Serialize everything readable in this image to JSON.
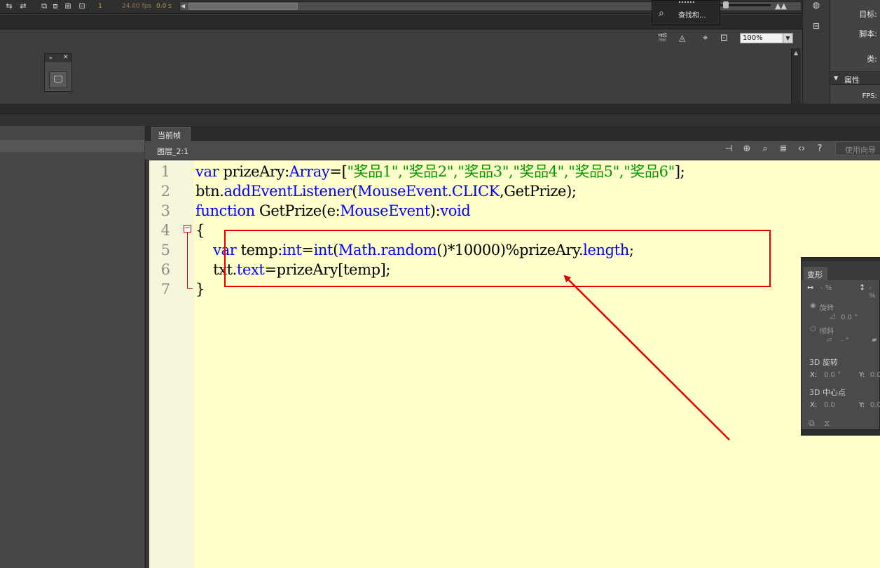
{
  "timeline": {
    "frame": "1",
    "fps": "24.00 fps",
    "time": "0.0 s"
  },
  "find_popup": {
    "label": "查找和..."
  },
  "stage": {
    "zoom": "100%"
  },
  "properties": {
    "target_label": "目标:",
    "script_label": "脚本:",
    "class_label": "类:",
    "section_title": "属性",
    "fps_label": "FPS:"
  },
  "actions": {
    "tab_current_frame": "当前帧",
    "layer": "图层_2:1",
    "wizard_button": "使用向导"
  },
  "code": {
    "line_numbers": [
      "1",
      "2",
      "3",
      "4",
      "5",
      "6",
      "7"
    ],
    "line1": {
      "kw1": "var",
      "t1": " prizeAry:",
      "kw2": "Array",
      "t2": "=[",
      "str": "\"奖品1\",\"奖品2\",\"奖品3\",\"奖品4\",\"奖品5\",\"奖品6\"",
      "t3": "];"
    },
    "line2": {
      "t1": "btn.",
      "kw1": "addEventListener",
      "t2": "(",
      "kw2": "MouseEvent.CLICK",
      "t3": ",GetPrize);"
    },
    "line3": {
      "kw1": "function",
      "t1": " GetPrize(e:",
      "kw2": "MouseEvent",
      "t2": "):",
      "kw3": "void"
    },
    "line4": {
      "t1": "{"
    },
    "line5": {
      "t0": "    ",
      "kw1": "var",
      "t1": " temp:",
      "kw2": "int",
      "t2": "=",
      "kw3": "int",
      "t3": "(",
      "kw4": "Math.random",
      "t4": "()*10000)%prizeAry.",
      "kw5": "length",
      "t5": ";"
    },
    "line6": {
      "t0": "    txt.",
      "kw1": "text",
      "t1": "=prizeAry[temp];"
    },
    "line7": {
      "t1": "}"
    }
  },
  "transform_panel": {
    "tab": "变形",
    "width_pct": "- %",
    "height_pct": "- %",
    "rotate_label": "旋转",
    "rotate_value": "0.0 °",
    "skew_label": "倾斜",
    "skew_value": "- °",
    "rot3d_label": "3D 旋转",
    "x_label": "X:",
    "x_value": "0.0 °",
    "y_label": "Y:",
    "y_value": "0.0",
    "center3d_label": "3D 中心点",
    "cx_label": "X:",
    "cx_value": "0.0",
    "cy_label": "Y:",
    "cy_value": "0.0"
  },
  "colors": {
    "keyword": "#0000ff",
    "string": "#009900",
    "editor_bg": "#ffffcc",
    "highlight": "#e00000",
    "timeline_number": "#c8a04a"
  }
}
